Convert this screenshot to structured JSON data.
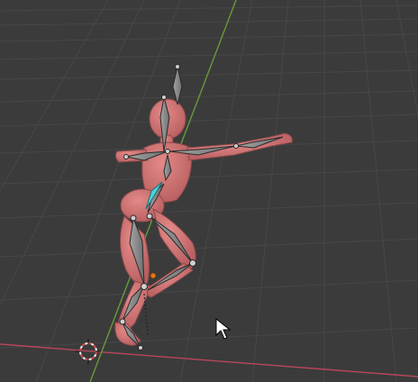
{
  "viewport": {
    "background": "#3b3b3b",
    "grid_color": "#4a4a4a",
    "axis_x_color": "#b8465a",
    "axis_y_color": "#6a9a3a"
  },
  "scene": {
    "mesh_color": "#d07474",
    "mesh_shade": "#b85e60",
    "bone_color": "#8e8e8e",
    "bone_edge": "#2a2a2a",
    "selected_bone_color": "#4fd0d8",
    "active_joint_color": "#e07a1a"
  },
  "icons": [
    "3d-cursor-icon",
    "mouse-pointer-icon"
  ]
}
